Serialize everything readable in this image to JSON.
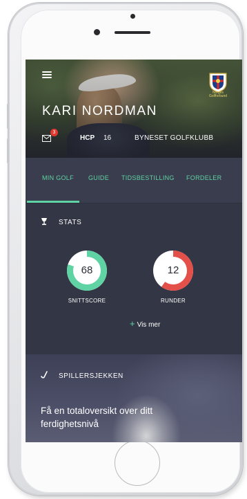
{
  "profile": {
    "name": "KARI NORDMAN",
    "unread_messages": "3",
    "hcp_label": "HCP",
    "hcp_value": "16",
    "club": "BYNESET GOLFKLUBB",
    "federation": "Norges Golfforbund"
  },
  "tabs": [
    {
      "label": "MIN GOLF",
      "active": true
    },
    {
      "label": "GUIDE",
      "active": false
    },
    {
      "label": "TIDSBESTILLING",
      "active": false
    },
    {
      "label": "FORDELER",
      "active": false
    }
  ],
  "stats": {
    "title": "STATS",
    "snittscore": {
      "value": "68",
      "label": "SNITTSCORE",
      "fill_fraction": 0.8,
      "color": "#5fd3a4"
    },
    "runder": {
      "value": "12",
      "label": "RUNDER",
      "fill_fraction": 0.6,
      "color": "#e3504a"
    },
    "more_label": "Vis mer"
  },
  "spillersjekken": {
    "title": "SPILLERSJEKKEN",
    "text": "Få en totaloversikt over ditt ferdighetsnivå"
  },
  "colors": {
    "accent": "#5fd3a4",
    "background": "#333644",
    "badge": "#e1392f"
  },
  "icons": [
    "menu-icon",
    "crest-icon",
    "mail-icon",
    "trophy-icon",
    "plus-icon",
    "checkmark-icon"
  ]
}
